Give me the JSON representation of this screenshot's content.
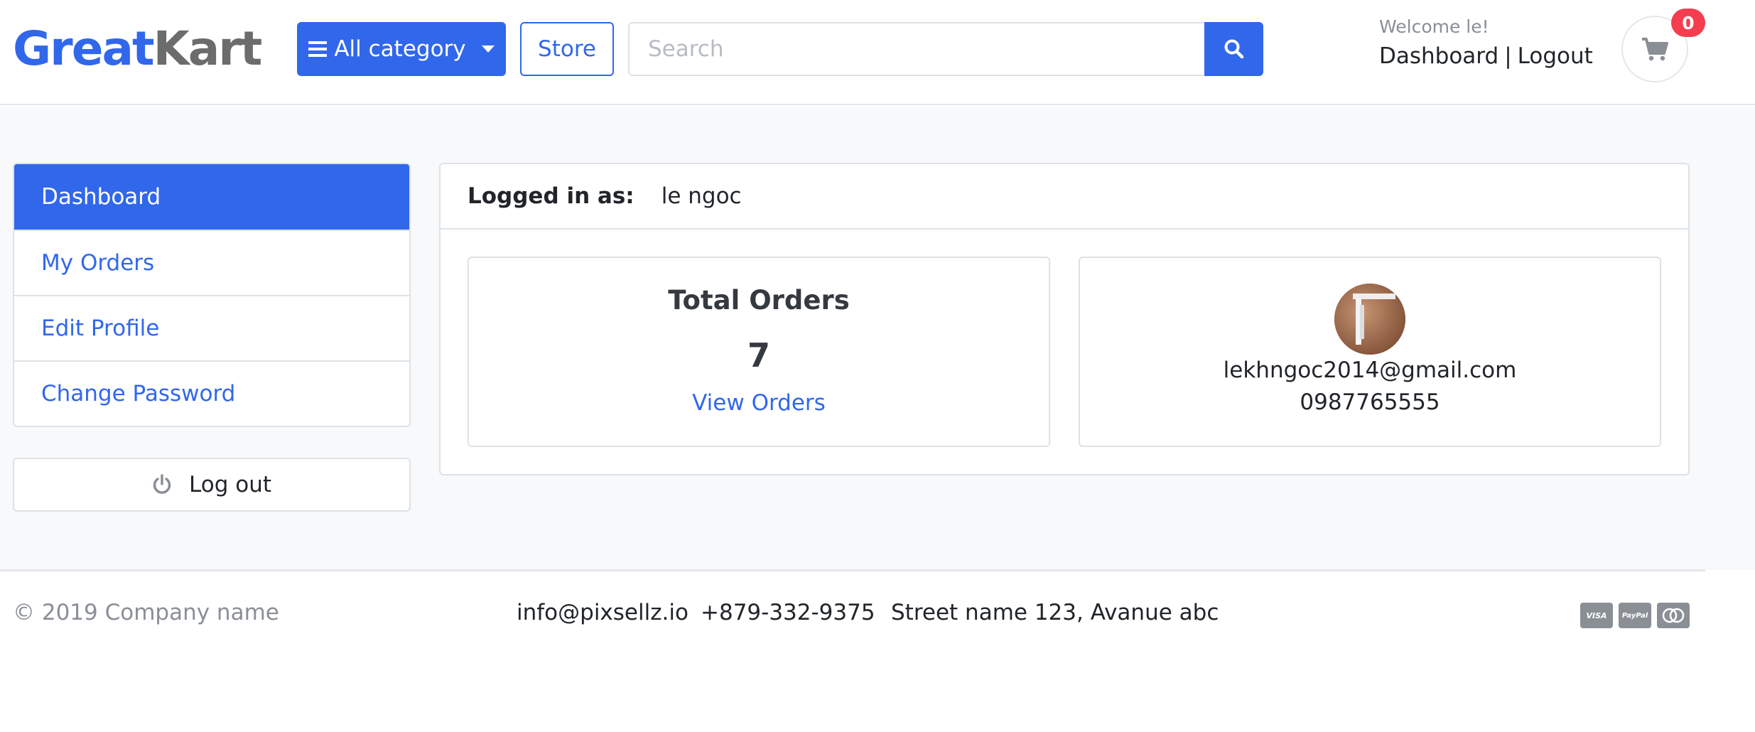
{
  "brand": {
    "part1": "Great",
    "part2": "Kart"
  },
  "header": {
    "category_label": "All category",
    "store_label": "Store",
    "search_placeholder": "Search",
    "welcome": "Welcome le!",
    "dashboard_link": "Dashboard",
    "separator": "|",
    "logout_link": "Logout",
    "cart_count": "0"
  },
  "sidebar": {
    "items": [
      {
        "label": "Dashboard",
        "active": true
      },
      {
        "label": "My Orders",
        "active": false
      },
      {
        "label": "Edit Profile",
        "active": false
      },
      {
        "label": "Change Password",
        "active": false
      }
    ],
    "logout_label": "Log out"
  },
  "dashboard": {
    "logged_in_label": "Logged in as:",
    "username": "le ngoc",
    "orders": {
      "title": "Total Orders",
      "count": "7",
      "link": "View Orders"
    },
    "profile": {
      "email": "lekhngoc2014@gmail.com",
      "phone": "0987765555"
    }
  },
  "footer": {
    "copyright": "© 2019 Company name",
    "email": "info@pixsellz.io",
    "phone": "+879-332-9375",
    "address": "Street name 123, Avanue abc",
    "payments": [
      "VISA",
      "PayPal",
      "mastercard"
    ]
  },
  "colors": {
    "primary": "#3167eb",
    "badge": "#f43e4f",
    "muted": "#8a8f96"
  }
}
